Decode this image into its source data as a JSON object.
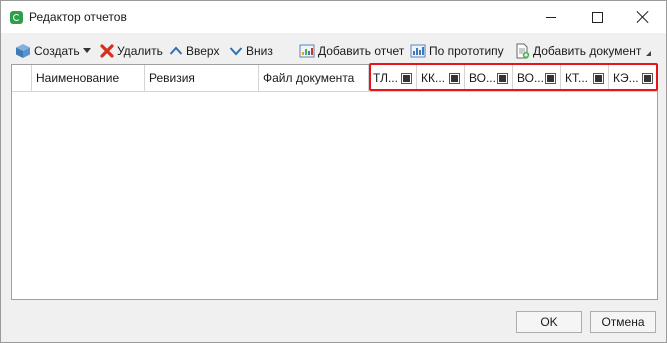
{
  "window": {
    "title": "Редактор отчетов",
    "icon": "app-logo-icon",
    "controls": [
      "minimize-icon",
      "maximize-icon",
      "close-icon"
    ]
  },
  "toolbar": {
    "create_label": "Создать",
    "delete_label": "Удалить",
    "up_label": "Вверх",
    "down_label": "Вниз",
    "add_report_label": "Добавить отчет",
    "by_prototype_label": "По прототипу",
    "add_document_label": "Добавить документ"
  },
  "grid": {
    "columns": [
      {
        "label": "Наименование"
      },
      {
        "label": "Ревизия"
      },
      {
        "label": "Файл документа"
      }
    ],
    "flag_columns": [
      {
        "label": "ТЛ...",
        "checked": true
      },
      {
        "label": "КК...",
        "checked": true
      },
      {
        "label": "ВО...",
        "checked": true
      },
      {
        "label": "ВО...",
        "checked": true
      },
      {
        "label": "КТ...",
        "checked": true
      },
      {
        "label": "КЭ...",
        "checked": true
      }
    ],
    "rows": []
  },
  "footer": {
    "ok_label": "OK",
    "cancel_label": "Отмена"
  },
  "colors": {
    "highlight": "#e8141b",
    "delete_icon": "#d6301f",
    "arrow_icon": "#2f6fb5",
    "app_icon": "#2e9e4a"
  }
}
